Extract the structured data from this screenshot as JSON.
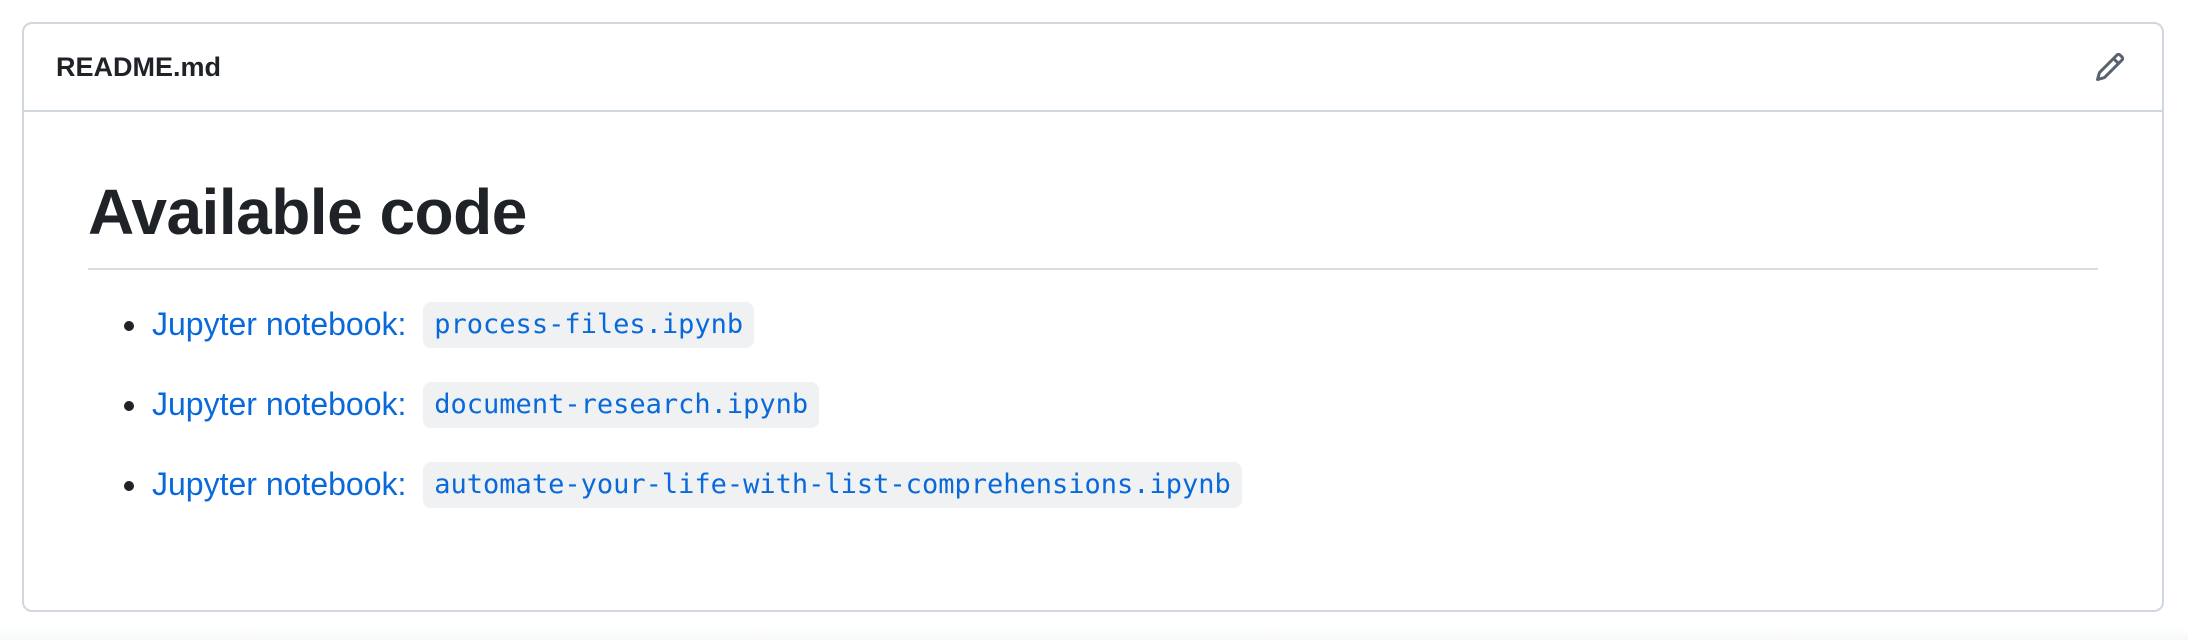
{
  "readme": {
    "filename": "README.md",
    "edit_icon": "pencil-icon",
    "heading": "Available code",
    "items": [
      {
        "prefix": "Jupyter notebook: ",
        "code": "process-files.ipynb"
      },
      {
        "prefix": "Jupyter notebook: ",
        "code": "document-research.ipynb"
      },
      {
        "prefix": "Jupyter notebook: ",
        "code": "automate-your-life-with-list-comprehensions.ipynb"
      }
    ]
  },
  "colors": {
    "link": "#0969da",
    "text": "#1f2328",
    "border": "#d0d7de",
    "code_bg": "#eff1f3"
  }
}
